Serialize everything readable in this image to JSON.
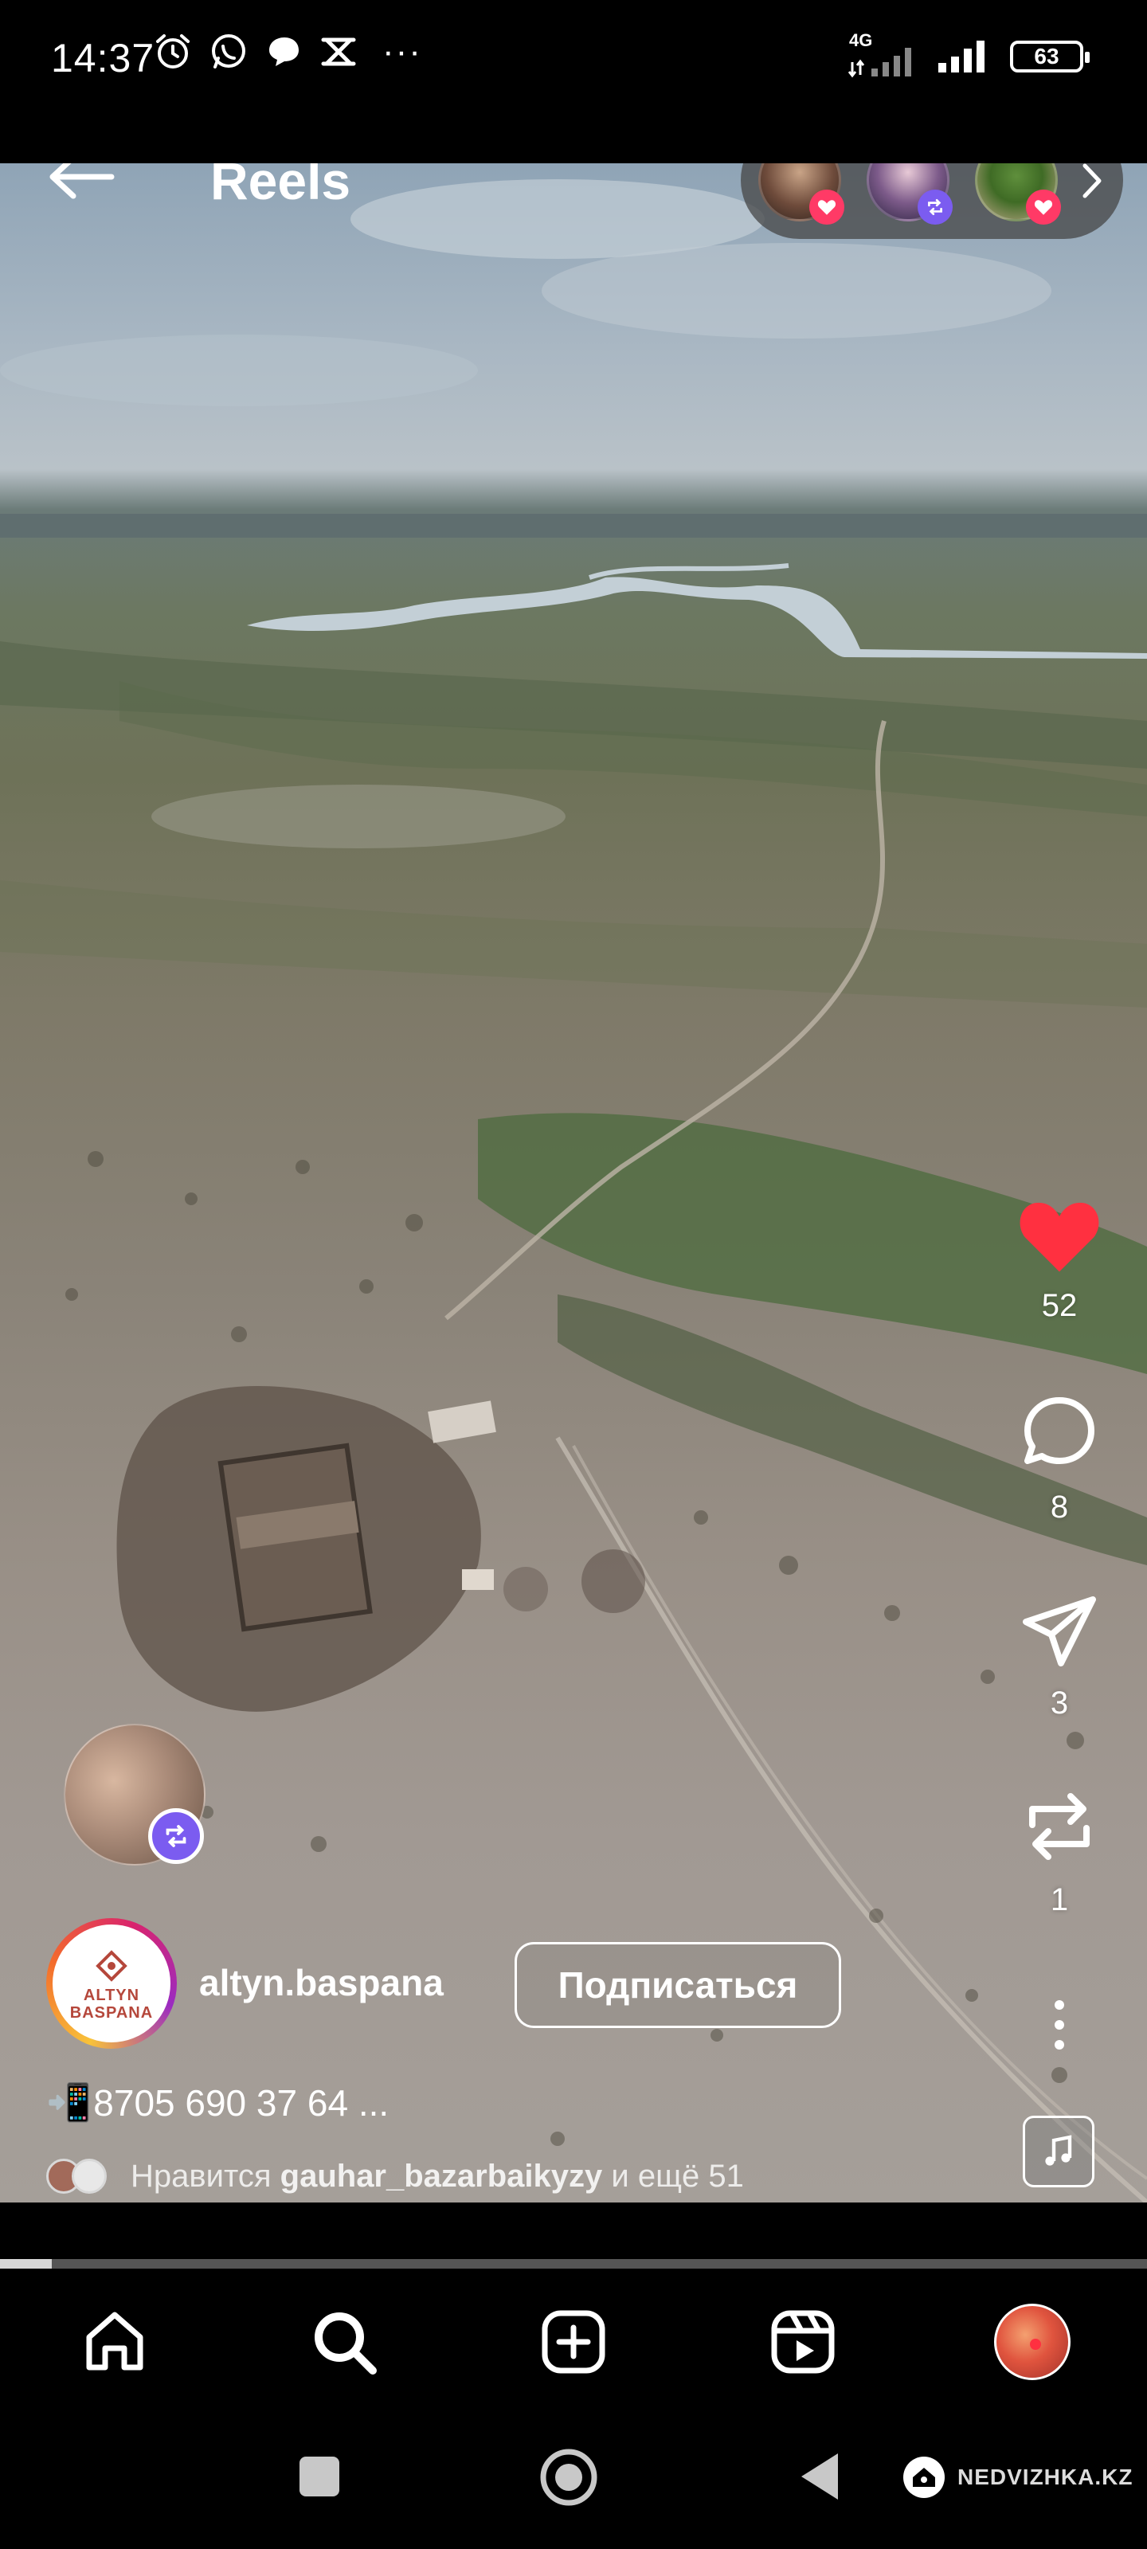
{
  "status_bar": {
    "time": "14:37",
    "network": "4G",
    "battery": "63",
    "more": "···"
  },
  "header": {
    "title": "Reels"
  },
  "rail": {
    "likes": "52",
    "comments": "8",
    "shares": "3",
    "reposts": "1"
  },
  "post": {
    "username": "altyn.baspana",
    "follow_label": "Подписаться",
    "profile_logo_line1": "ALTYN",
    "profile_logo_line2": "BASPANA",
    "caption_emoji": "📲",
    "caption": "8705 690 37 64 ...",
    "liked_prefix": "Нравится",
    "liked_user": "gauhar_bazarbaikyzy",
    "liked_suffix": "и ещё 51"
  },
  "progress": {
    "fraction": 0.045
  },
  "watermark": {
    "text": "NEDVIZHKA.KZ"
  },
  "colors": {
    "like_red": "#ff3040",
    "repost_purple": "#7b5cf0"
  }
}
